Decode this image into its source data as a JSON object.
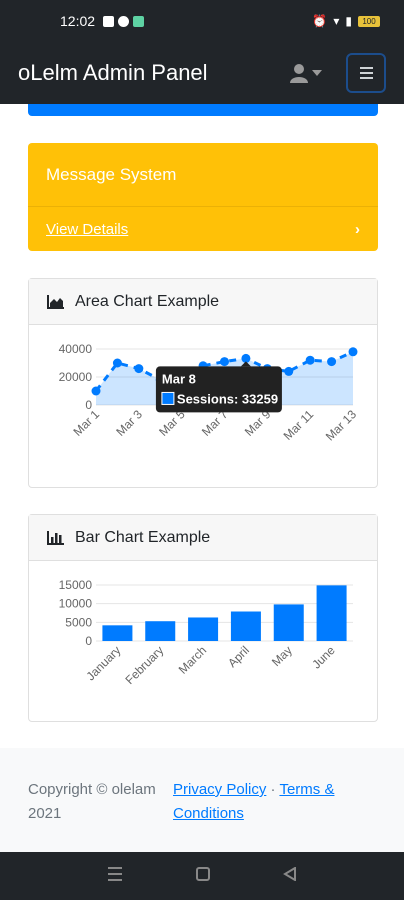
{
  "status_bar": {
    "time": "12:02",
    "battery": "100"
  },
  "navbar": {
    "brand": "oLelm Admin Panel"
  },
  "message_card": {
    "title": "Message System",
    "link": "View Details"
  },
  "area_chart": {
    "title": "Area Chart Example",
    "tooltip": {
      "title": "Mar 8",
      "label": "Sessions: 33259"
    }
  },
  "bar_chart": {
    "title": "Bar Chart Example"
  },
  "footer": {
    "copyright": "Copyright © olelam 2021",
    "privacy": "Privacy Policy",
    "separator": "·",
    "terms": "Terms & Conditions"
  },
  "chart_data": [
    {
      "type": "area",
      "title": "Area Chart Example",
      "x": [
        "Mar 1",
        "Mar 2",
        "Mar 3",
        "Mar 4",
        "Mar 5",
        "Mar 6",
        "Mar 7",
        "Mar 8",
        "Mar 9",
        "Mar 10",
        "Mar 11",
        "Mar 12",
        "Mar 13"
      ],
      "x_tick_labels": [
        "Mar 1",
        "Mar 3",
        "Mar 5",
        "Mar 7",
        "Mar 9",
        "Mar 11",
        "Mar 13"
      ],
      "series": [
        {
          "name": "Sessions",
          "values": [
            10000,
            30000,
            26000,
            18000,
            17000,
            28000,
            31000,
            33259,
            26000,
            24000,
            32000,
            31000,
            38000
          ]
        }
      ],
      "y_ticks": [
        "0",
        "20000",
        "40000"
      ],
      "ylim": [
        0,
        40000
      ],
      "grid": true,
      "color": "#007bff"
    },
    {
      "type": "bar",
      "title": "Bar Chart Example",
      "categories": [
        "January",
        "February",
        "March",
        "April",
        "May",
        "June"
      ],
      "values": [
        4200,
        5300,
        6300,
        7900,
        9800,
        14900
      ],
      "y_ticks": [
        "0",
        "5000",
        "10000",
        "15000"
      ],
      "ylim": [
        0,
        15000
      ],
      "grid": true,
      "color": "#007bff"
    }
  ]
}
